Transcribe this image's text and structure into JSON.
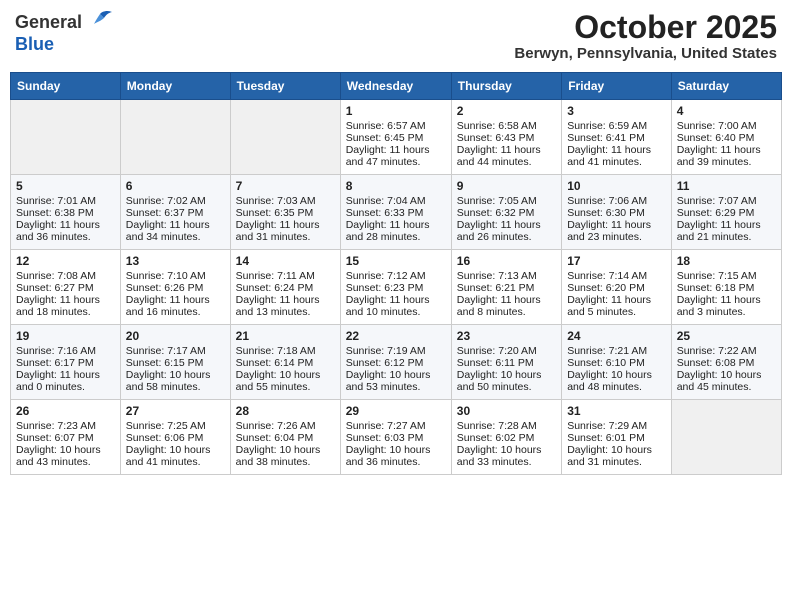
{
  "header": {
    "logo_general": "General",
    "logo_blue": "Blue",
    "title": "October 2025",
    "subtitle": "Berwyn, Pennsylvania, United States"
  },
  "days_of_week": [
    "Sunday",
    "Monday",
    "Tuesday",
    "Wednesday",
    "Thursday",
    "Friday",
    "Saturday"
  ],
  "weeks": [
    {
      "cells": [
        {
          "day": null,
          "content": ""
        },
        {
          "day": null,
          "content": ""
        },
        {
          "day": null,
          "content": ""
        },
        {
          "day": "1",
          "content": "Sunrise: 6:57 AM\nSunset: 6:45 PM\nDaylight: 11 hours and 47 minutes."
        },
        {
          "day": "2",
          "content": "Sunrise: 6:58 AM\nSunset: 6:43 PM\nDaylight: 11 hours and 44 minutes."
        },
        {
          "day": "3",
          "content": "Sunrise: 6:59 AM\nSunset: 6:41 PM\nDaylight: 11 hours and 41 minutes."
        },
        {
          "day": "4",
          "content": "Sunrise: 7:00 AM\nSunset: 6:40 PM\nDaylight: 11 hours and 39 minutes."
        }
      ]
    },
    {
      "cells": [
        {
          "day": "5",
          "content": "Sunrise: 7:01 AM\nSunset: 6:38 PM\nDaylight: 11 hours and 36 minutes."
        },
        {
          "day": "6",
          "content": "Sunrise: 7:02 AM\nSunset: 6:37 PM\nDaylight: 11 hours and 34 minutes."
        },
        {
          "day": "7",
          "content": "Sunrise: 7:03 AM\nSunset: 6:35 PM\nDaylight: 11 hours and 31 minutes."
        },
        {
          "day": "8",
          "content": "Sunrise: 7:04 AM\nSunset: 6:33 PM\nDaylight: 11 hours and 28 minutes."
        },
        {
          "day": "9",
          "content": "Sunrise: 7:05 AM\nSunset: 6:32 PM\nDaylight: 11 hours and 26 minutes."
        },
        {
          "day": "10",
          "content": "Sunrise: 7:06 AM\nSunset: 6:30 PM\nDaylight: 11 hours and 23 minutes."
        },
        {
          "day": "11",
          "content": "Sunrise: 7:07 AM\nSunset: 6:29 PM\nDaylight: 11 hours and 21 minutes."
        }
      ]
    },
    {
      "cells": [
        {
          "day": "12",
          "content": "Sunrise: 7:08 AM\nSunset: 6:27 PM\nDaylight: 11 hours and 18 minutes."
        },
        {
          "day": "13",
          "content": "Sunrise: 7:10 AM\nSunset: 6:26 PM\nDaylight: 11 hours and 16 minutes."
        },
        {
          "day": "14",
          "content": "Sunrise: 7:11 AM\nSunset: 6:24 PM\nDaylight: 11 hours and 13 minutes."
        },
        {
          "day": "15",
          "content": "Sunrise: 7:12 AM\nSunset: 6:23 PM\nDaylight: 11 hours and 10 minutes."
        },
        {
          "day": "16",
          "content": "Sunrise: 7:13 AM\nSunset: 6:21 PM\nDaylight: 11 hours and 8 minutes."
        },
        {
          "day": "17",
          "content": "Sunrise: 7:14 AM\nSunset: 6:20 PM\nDaylight: 11 hours and 5 minutes."
        },
        {
          "day": "18",
          "content": "Sunrise: 7:15 AM\nSunset: 6:18 PM\nDaylight: 11 hours and 3 minutes."
        }
      ]
    },
    {
      "cells": [
        {
          "day": "19",
          "content": "Sunrise: 7:16 AM\nSunset: 6:17 PM\nDaylight: 11 hours and 0 minutes."
        },
        {
          "day": "20",
          "content": "Sunrise: 7:17 AM\nSunset: 6:15 PM\nDaylight: 10 hours and 58 minutes."
        },
        {
          "day": "21",
          "content": "Sunrise: 7:18 AM\nSunset: 6:14 PM\nDaylight: 10 hours and 55 minutes."
        },
        {
          "day": "22",
          "content": "Sunrise: 7:19 AM\nSunset: 6:12 PM\nDaylight: 10 hours and 53 minutes."
        },
        {
          "day": "23",
          "content": "Sunrise: 7:20 AM\nSunset: 6:11 PM\nDaylight: 10 hours and 50 minutes."
        },
        {
          "day": "24",
          "content": "Sunrise: 7:21 AM\nSunset: 6:10 PM\nDaylight: 10 hours and 48 minutes."
        },
        {
          "day": "25",
          "content": "Sunrise: 7:22 AM\nSunset: 6:08 PM\nDaylight: 10 hours and 45 minutes."
        }
      ]
    },
    {
      "cells": [
        {
          "day": "26",
          "content": "Sunrise: 7:23 AM\nSunset: 6:07 PM\nDaylight: 10 hours and 43 minutes."
        },
        {
          "day": "27",
          "content": "Sunrise: 7:25 AM\nSunset: 6:06 PM\nDaylight: 10 hours and 41 minutes."
        },
        {
          "day": "28",
          "content": "Sunrise: 7:26 AM\nSunset: 6:04 PM\nDaylight: 10 hours and 38 minutes."
        },
        {
          "day": "29",
          "content": "Sunrise: 7:27 AM\nSunset: 6:03 PM\nDaylight: 10 hours and 36 minutes."
        },
        {
          "day": "30",
          "content": "Sunrise: 7:28 AM\nSunset: 6:02 PM\nDaylight: 10 hours and 33 minutes."
        },
        {
          "day": "31",
          "content": "Sunrise: 7:29 AM\nSunset: 6:01 PM\nDaylight: 10 hours and 31 minutes."
        },
        {
          "day": null,
          "content": ""
        }
      ]
    }
  ]
}
